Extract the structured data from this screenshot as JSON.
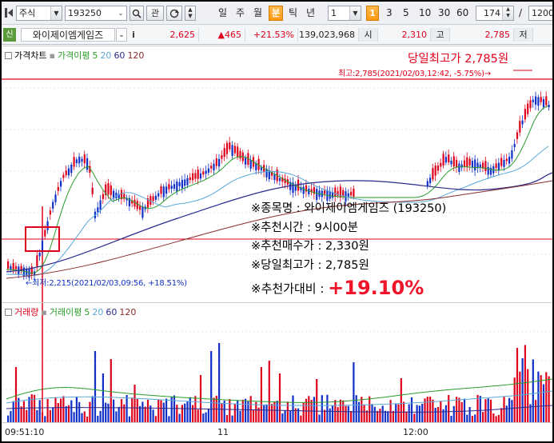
{
  "toolbar": {
    "market_select": "주식",
    "code_input": "193250",
    "search_icon": "search-icon",
    "gwan_button": "관",
    "period_buttons": [
      "일",
      "주",
      "월",
      "분",
      "틱",
      "년"
    ],
    "active_period": "분",
    "interval_value": "1",
    "interval_buttons": [
      "1",
      "3",
      "5",
      "10",
      "30",
      "60"
    ],
    "active_interval": "1",
    "count_value": "174",
    "slash": "/",
    "total_value": "1200"
  },
  "quote": {
    "sin_badge": "신",
    "stock_name": "와이제이엠게임즈",
    "info_icon": "i",
    "price": "2,625",
    "change": "▲465",
    "change_pct": "+21.53%",
    "volume": "139,023,968",
    "open_label": "시",
    "open_value": "2,310",
    "high_label": "고",
    "high_value": "2,785",
    "low_label": "저"
  },
  "price_panel": {
    "legend_title": "가격차트",
    "legend_ma_label": "가격이평",
    "legend_ma_values": [
      "5",
      "20",
      "60",
      "120"
    ],
    "day_high_annotation": "당일최고가 2,785원",
    "high_marker": "최고:2,785(2021/02/03,12:42, -5.75%)→",
    "low_marker": "←최저:2,215(2021/02/03,09:56, +18.51%)"
  },
  "overlay": {
    "stock_line_label": "※종목명 :",
    "stock_line_value": "와이제이엠게임즈 (193250)",
    "time_label": "※추천시간 :",
    "time_value": "9시00분",
    "buy_label": "※추천매수가 :",
    "buy_value": "2,330원",
    "high_label": "※당일최고가 :",
    "high_value": "2,785원",
    "ratio_label": "※추천가대비 :",
    "ratio_value": "+19.10%"
  },
  "vol_panel": {
    "legend_title": "거래량",
    "legend_ma_label": "거래이평",
    "legend_ma_values": [
      "5",
      "20",
      "60",
      "120"
    ]
  },
  "x_axis": {
    "ticks": [
      "09:51:10",
      "11",
      "12:00"
    ]
  },
  "colors": {
    "up": "#e0001b",
    "down": "#1030c8",
    "ma5": "#2a9d2a",
    "ma20": "#5aa8d8",
    "ma60": "#2a2a8c",
    "ma120": "#8b2a2a",
    "orange_selected": "#ff9a10"
  }
}
